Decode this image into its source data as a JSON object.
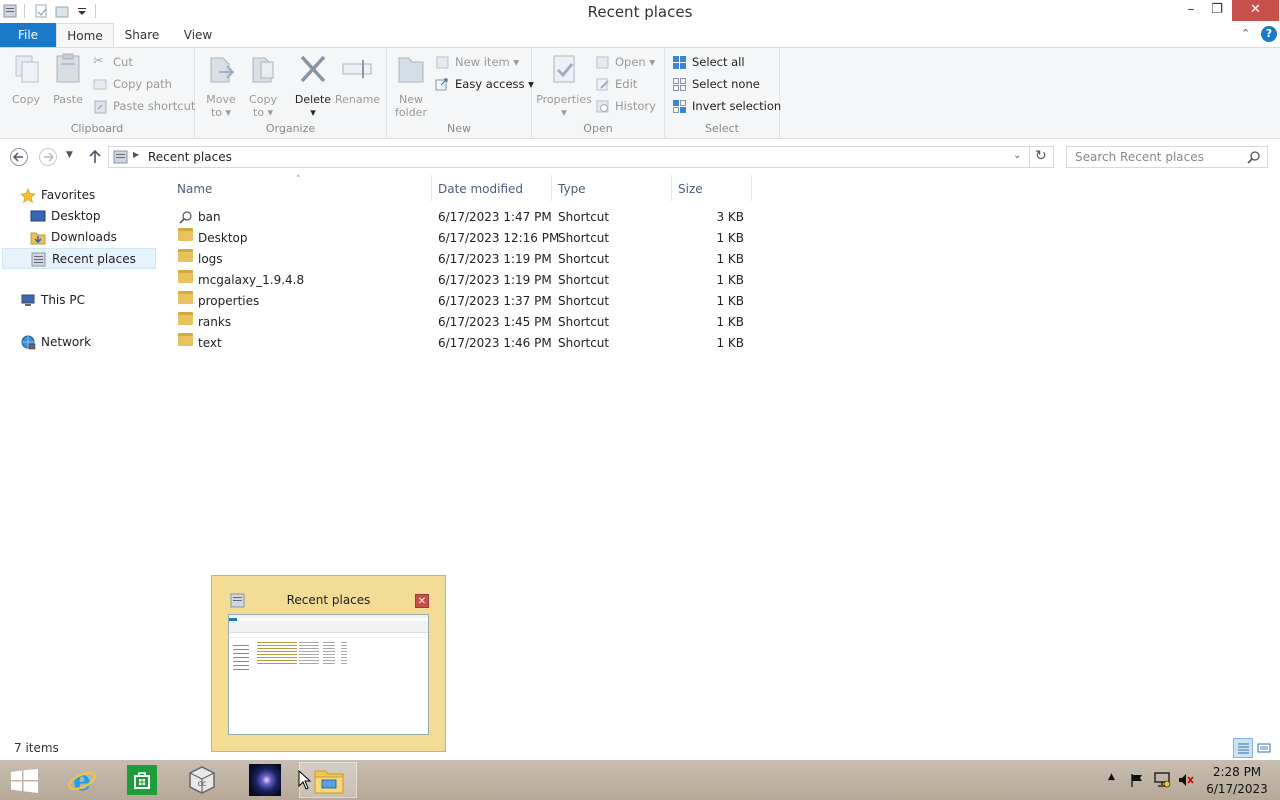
{
  "window": {
    "title": "Recent places"
  },
  "tabs": {
    "file": "File",
    "home": "Home",
    "share": "Share",
    "view": "View"
  },
  "ribbon": {
    "clipboard": {
      "copy": "Copy",
      "paste": "Paste",
      "cut": "Cut",
      "copy_path": "Copy path",
      "paste_shortcut": "Paste shortcut",
      "label": "Clipboard"
    },
    "organize": {
      "move_to_1": "Move",
      "move_to_2": "to",
      "copy_to_1": "Copy",
      "copy_to_2": "to",
      "delete": "Delete",
      "rename": "Rename",
      "label": "Organize"
    },
    "new": {
      "new_folder_1": "New",
      "new_folder_2": "folder",
      "new_item": "New item",
      "easy_access": "Easy access",
      "label": "New"
    },
    "open": {
      "properties": "Properties",
      "open": "Open",
      "edit": "Edit",
      "history": "History",
      "label": "Open"
    },
    "select": {
      "select_all": "Select all",
      "select_none": "Select none",
      "invert_selection": "Invert selection",
      "label": "Select"
    }
  },
  "address": {
    "path": "Recent places",
    "search_placeholder": "Search Recent places"
  },
  "nav": {
    "favorites": "Favorites",
    "desktop": "Desktop",
    "downloads": "Downloads",
    "recent_places": "Recent places",
    "this_pc": "This PC",
    "network": "Network"
  },
  "columns": {
    "name": "Name",
    "date_modified": "Date modified",
    "type": "Type",
    "size": "Size"
  },
  "files": [
    {
      "name": "ban",
      "date": "6/17/2023 1:47 PM",
      "type": "Shortcut",
      "size": "3 KB",
      "icon": "search-icon"
    },
    {
      "name": "Desktop",
      "date": "6/17/2023 12:16 PM",
      "type": "Shortcut",
      "size": "1 KB",
      "icon": "folder-icon"
    },
    {
      "name": "logs",
      "date": "6/17/2023 1:19 PM",
      "type": "Shortcut",
      "size": "1 KB",
      "icon": "folder-icon"
    },
    {
      "name": "mcgalaxy_1.9.4.8",
      "date": "6/17/2023 1:19 PM",
      "type": "Shortcut",
      "size": "1 KB",
      "icon": "folder-icon"
    },
    {
      "name": "properties",
      "date": "6/17/2023 1:37 PM",
      "type": "Shortcut",
      "size": "1 KB",
      "icon": "folder-icon"
    },
    {
      "name": "ranks",
      "date": "6/17/2023 1:45 PM",
      "type": "Shortcut",
      "size": "1 KB",
      "icon": "folder-icon"
    },
    {
      "name": "text",
      "date": "6/17/2023 1:46 PM",
      "type": "Shortcut",
      "size": "1 KB",
      "icon": "folder-icon"
    }
  ],
  "status": {
    "item_count": "7 items"
  },
  "thumbnail": {
    "title": "Recent places"
  },
  "tray": {
    "time": "2:28 PM",
    "date": "6/17/2023"
  },
  "colors": {
    "accent": "#1979ca",
    "close": "#c7504a",
    "taskbar": "#bfb2a5",
    "thumb_bg": "#f2dc96"
  }
}
